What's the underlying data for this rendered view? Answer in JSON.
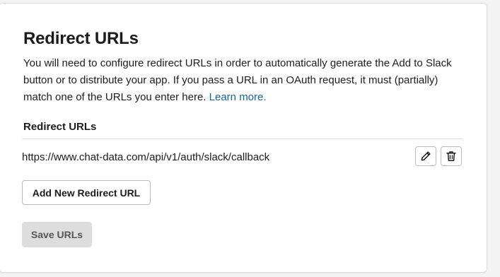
{
  "section": {
    "title": "Redirect URLs",
    "description_text": "You will need to configure redirect URLs in order to automatically generate the Add to Slack button or to distribute your app. If you pass a URL in an OAuth request, it must (partially) match one of the URLs you enter here.",
    "learn_more_label": "Learn more.",
    "list_label": "Redirect URLs"
  },
  "redirect_urls": [
    {
      "url": "https://www.chat-data.com/api/v1/auth/slack/callback",
      "edit_icon": "pencil-icon",
      "delete_icon": "trash-icon"
    }
  ],
  "buttons": {
    "add_label": "Add New Redirect URL",
    "save_label": "Save URLs",
    "save_disabled": true
  },
  "colors": {
    "link": "#1264a3",
    "text": "#1d1c1d",
    "disabled_button_bg": "#dddddd",
    "border": "#bbbbbb"
  }
}
